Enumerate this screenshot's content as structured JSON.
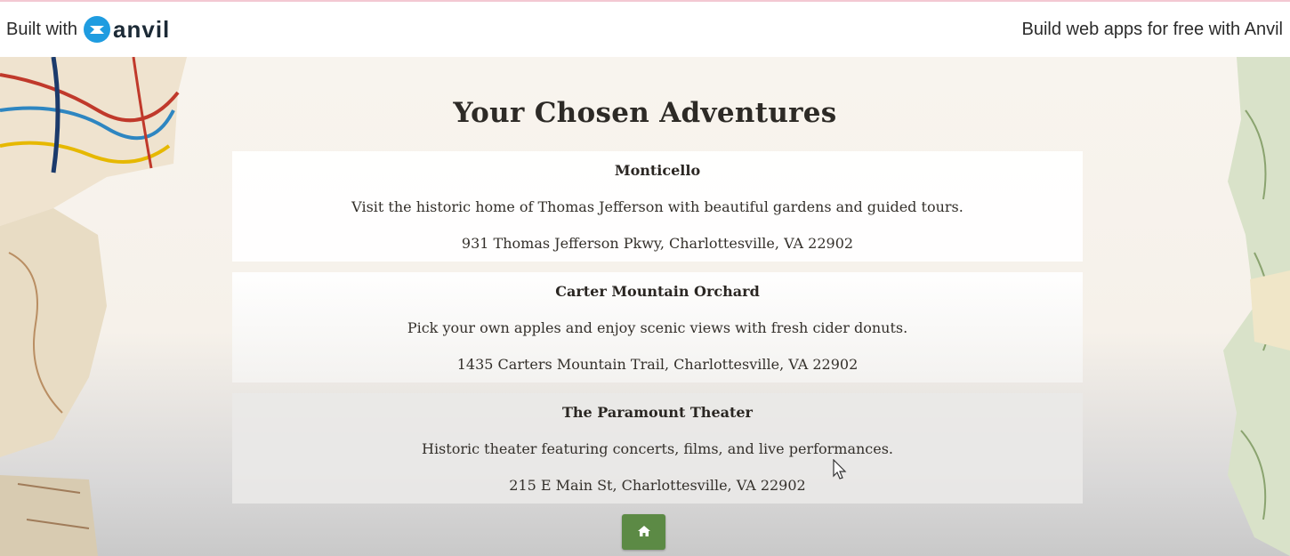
{
  "banner": {
    "built_with": "Built with",
    "brand": "anvil",
    "build_link": "Build web apps for free with Anvil"
  },
  "page": {
    "title": "Your Chosen Adventures"
  },
  "adventures": [
    {
      "name": "Monticello",
      "description": "Visit the historic home of Thomas Jefferson with beautiful gardens and guided tours.",
      "address": "931 Thomas Jefferson Pkwy, Charlottesville, VA 22902"
    },
    {
      "name": "Carter Mountain Orchard",
      "description": "Pick your own apples and enjoy scenic views with fresh cider donuts.",
      "address": "1435 Carters Mountain Trail, Charlottesville, VA 22902"
    },
    {
      "name": "The Paramount Theater",
      "description": "Historic theater featuring concerts, films, and live performances.",
      "address": "215 E Main St, Charlottesville, VA 22902"
    }
  ],
  "colors": {
    "button": "#5c8a45",
    "anvil_blue": "#1f9ce0"
  },
  "icons": {
    "home_button": "home-icon",
    "brand": "anvil-logo-icon"
  }
}
